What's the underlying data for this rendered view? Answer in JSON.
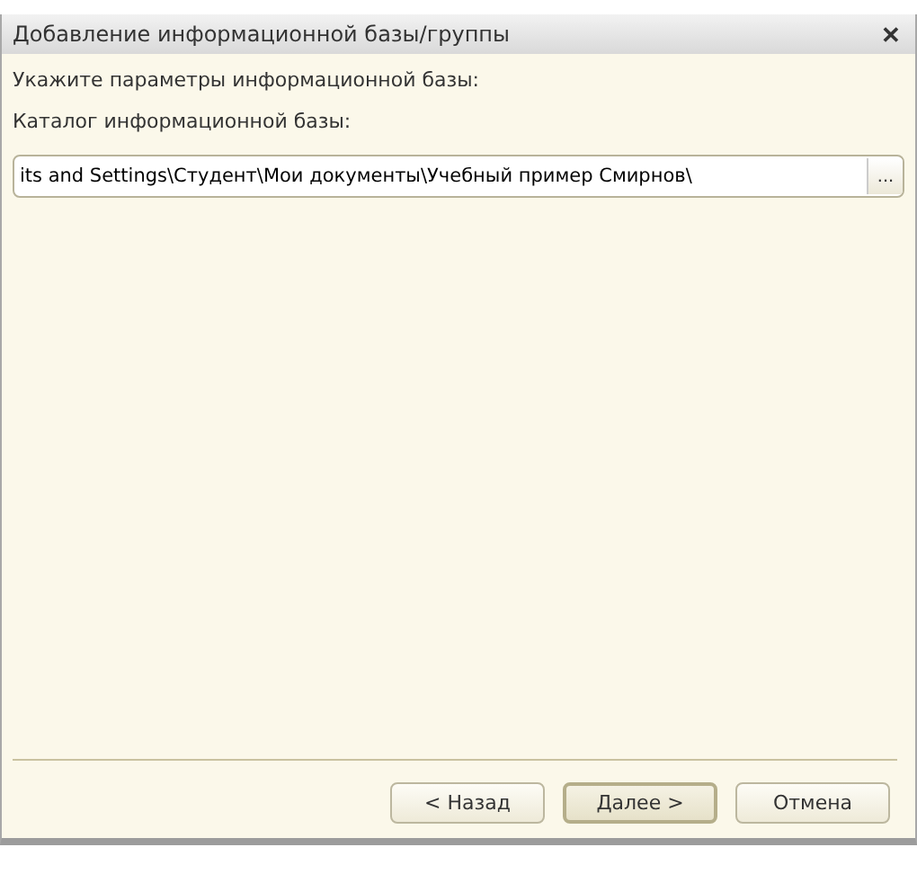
{
  "window": {
    "title": "Добавление информационной базы/группы",
    "close": "✕"
  },
  "prompt": "Укажите параметры информационной базы:",
  "directory": {
    "label": "Каталог информационной базы:",
    "value": "its and Settings\\Студент\\Мои документы\\Учебный пример Смирнов\\",
    "browse": "..."
  },
  "buttons": [
    {
      "label": "< Назад",
      "selected": false
    },
    {
      "label": "Далее >",
      "selected": true
    },
    {
      "label": "Отмена",
      "selected": false
    }
  ]
}
